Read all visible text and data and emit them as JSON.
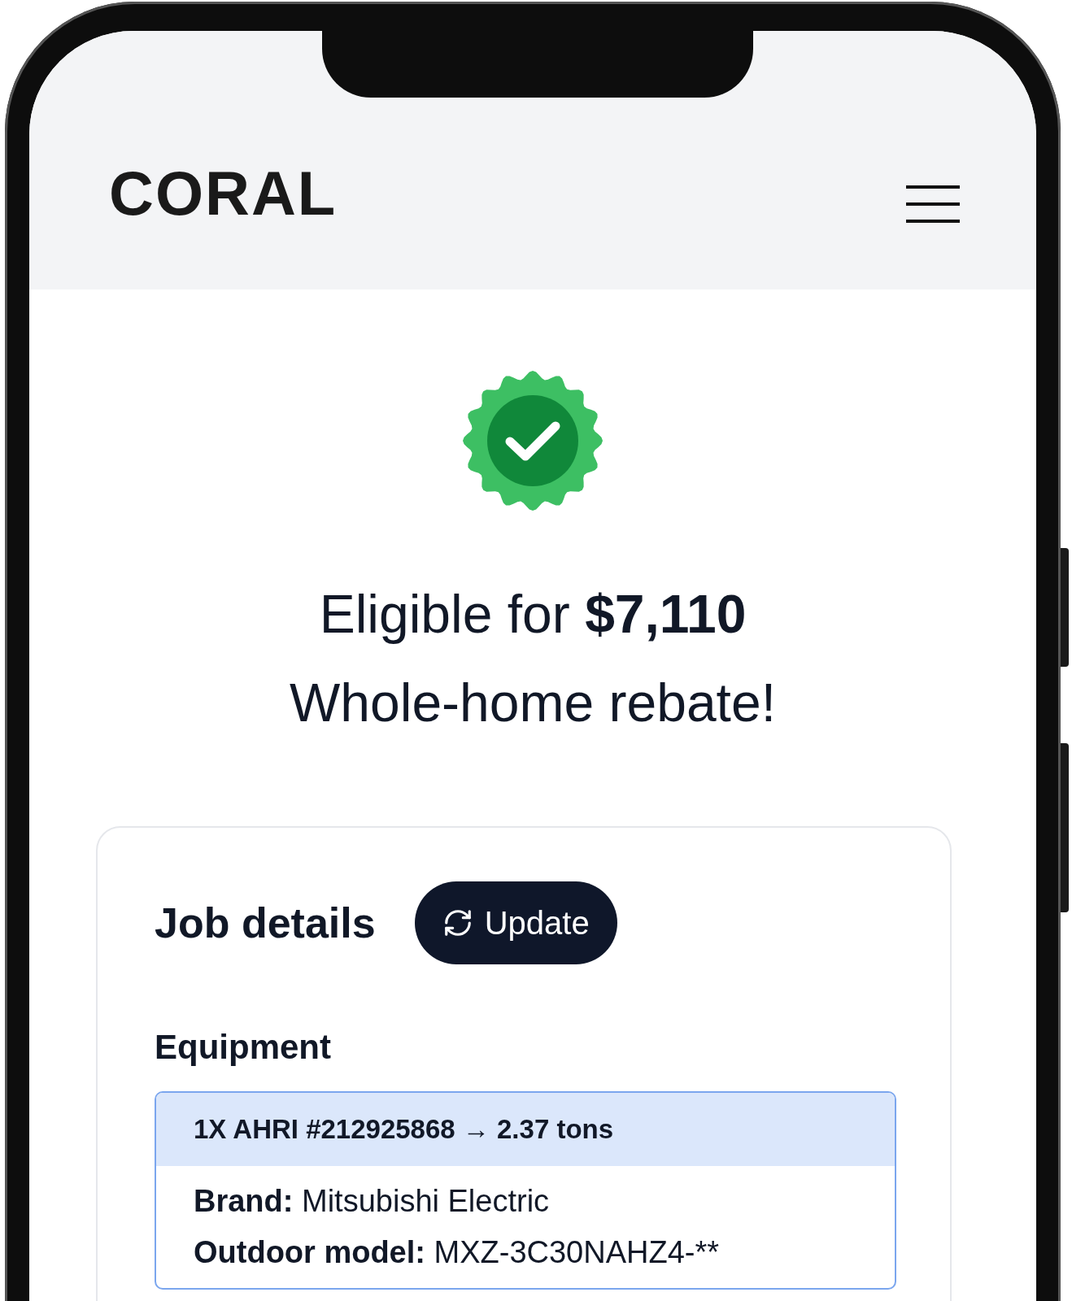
{
  "brand": {
    "logo": "CORAL"
  },
  "result": {
    "line_1": "Eligible for **$7,110**",
    "line_2": "Whole-home rebate!"
  },
  "job_details": {
    "title": "Job details",
    "update_button": "Update",
    "section": "Equipment",
    "equipment": [
      {
        "header": "1X AHRI #212925868 → 2.37 tons",
        "fields": [
          {
            "label": "Brand:",
            "value": "Mitsubishi Electric"
          },
          {
            "label": "Outdoor model:",
            "value": "MXZ-3C30NAHZ4-**"
          }
        ]
      }
    ]
  }
}
